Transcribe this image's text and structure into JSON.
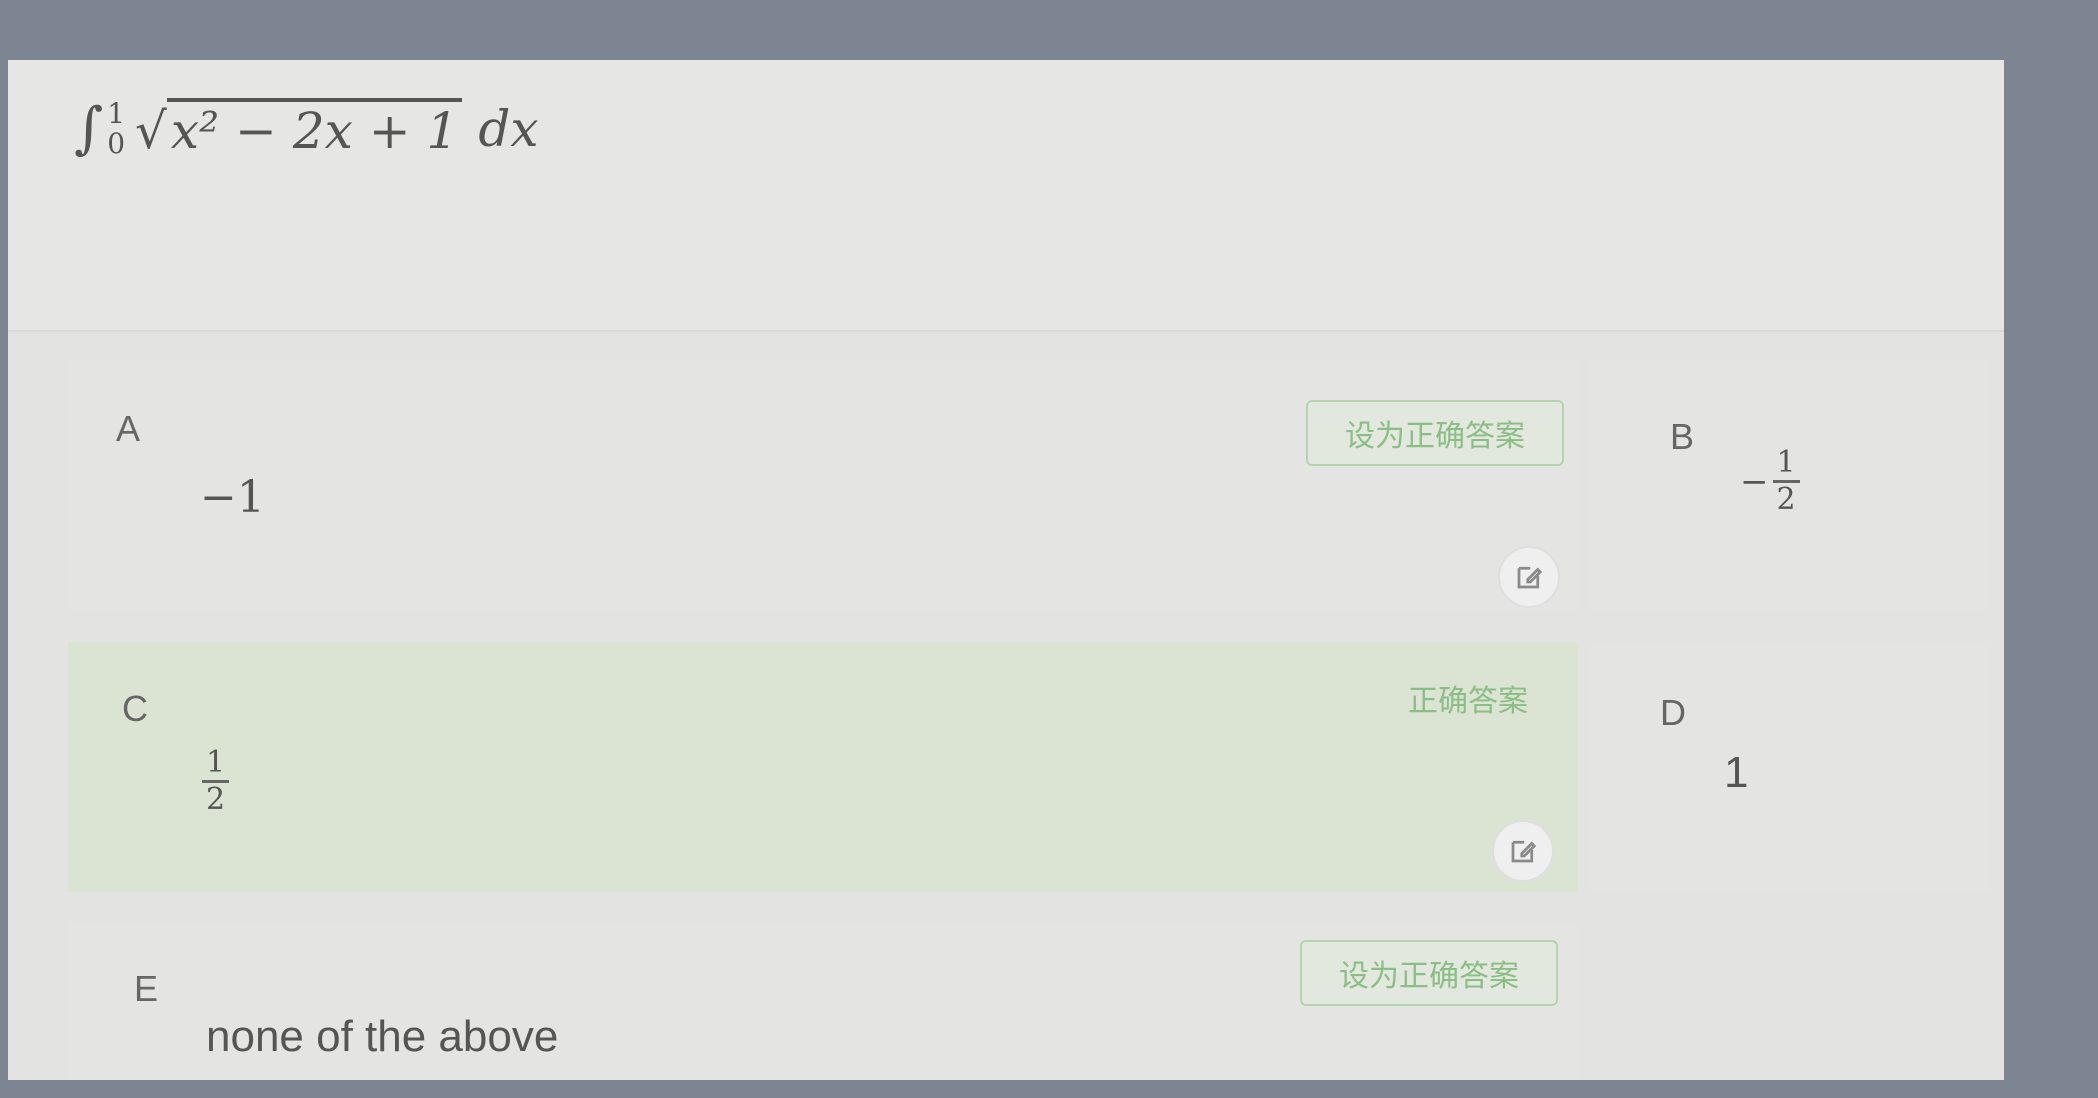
{
  "question": {
    "integral_sign": "∫",
    "lower_limit": "0",
    "upper_limit": "1",
    "radicand": "x² − 2x + 1",
    "differential": "dx"
  },
  "options": [
    {
      "letter": "A",
      "value": "−1",
      "action_label": "设为正确答案"
    },
    {
      "letter": "B",
      "value_sign": "−",
      "value_num": "1",
      "value_den": "2"
    },
    {
      "letter": "C",
      "value_num": "1",
      "value_den": "2",
      "correct_label": "正确答案"
    },
    {
      "letter": "D",
      "value": "1"
    },
    {
      "letter": "E",
      "value": "none of the above",
      "action_label": "设为正确答案"
    }
  ],
  "icons": {
    "edit": "edit-icon"
  },
  "colors": {
    "accent_green": "#8bbd86",
    "correct_bg": "#dbe3d3"
  }
}
